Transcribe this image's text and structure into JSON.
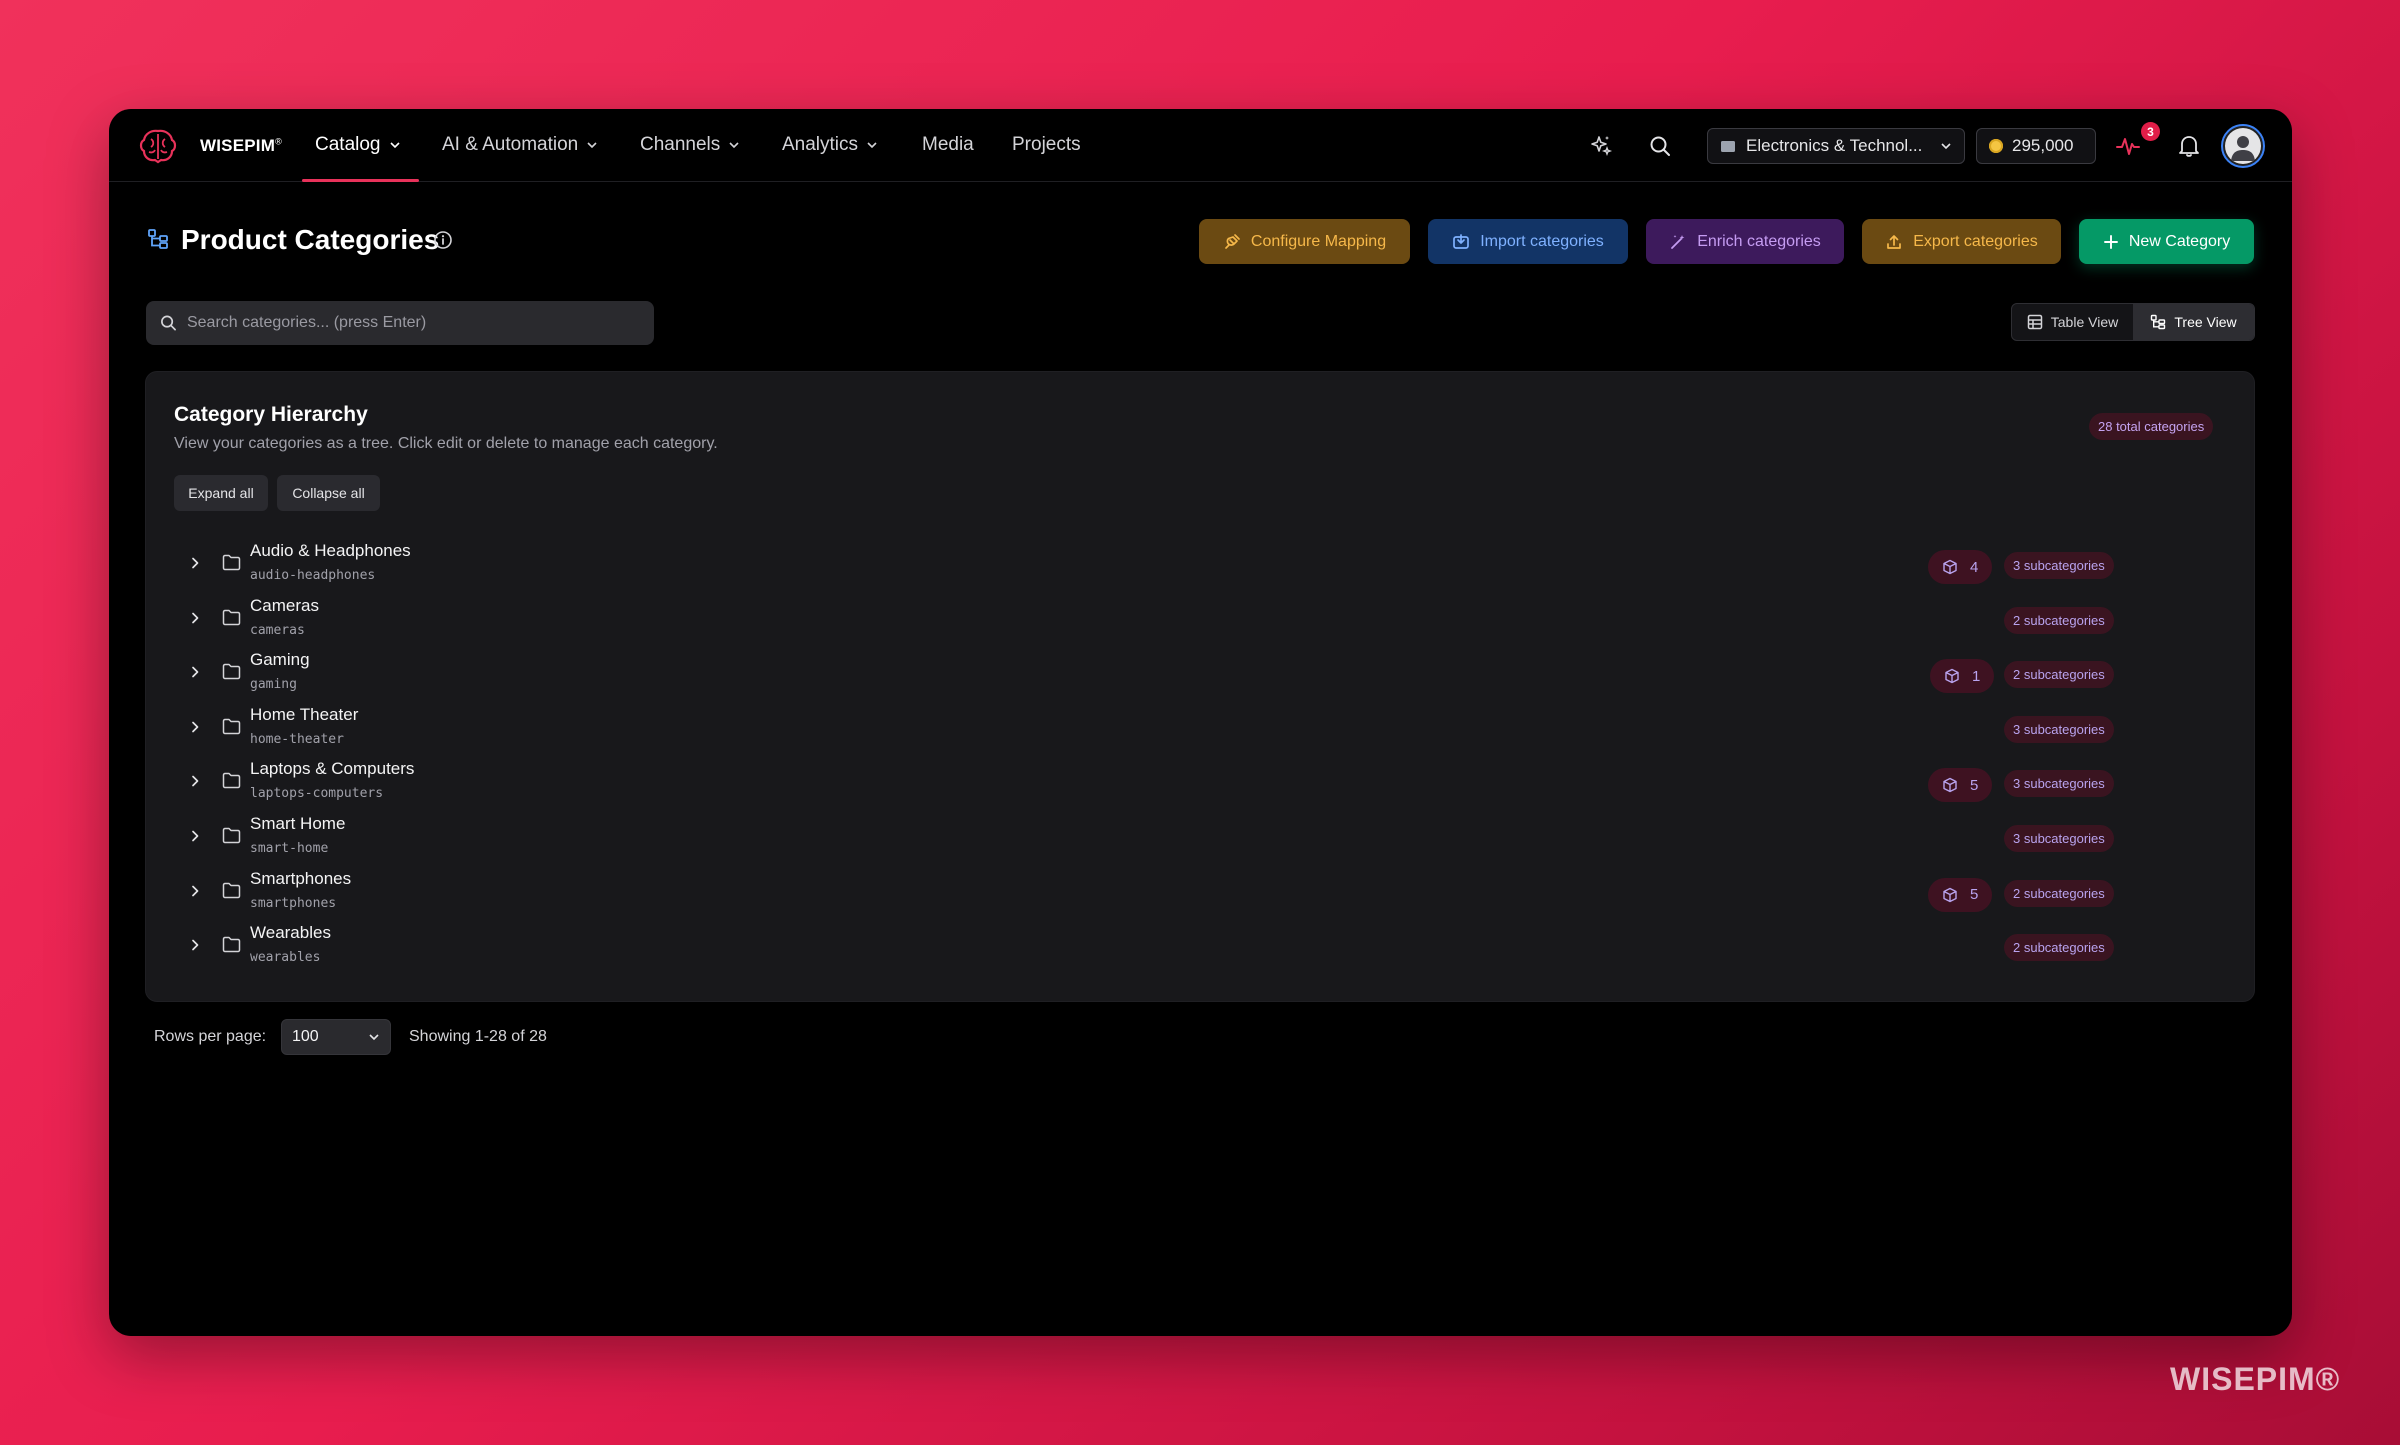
{
  "brand": {
    "name": "WISEPIM",
    "mark": "®"
  },
  "nav": {
    "items": [
      {
        "label": "Catalog",
        "active": true,
        "dropdown": true
      },
      {
        "label": "AI & Automation",
        "dropdown": true
      },
      {
        "label": "Channels",
        "dropdown": true
      },
      {
        "label": "Analytics",
        "dropdown": true
      },
      {
        "label": "Media",
        "dropdown": false
      },
      {
        "label": "Projects",
        "dropdown": false
      }
    ],
    "org_select": "Electronics & Technol...",
    "credits": "295,000",
    "activity_count": "3"
  },
  "page": {
    "title": "Product Categories",
    "actions": {
      "configure_mapping": "Configure Mapping",
      "import": "Import categories",
      "enrich": "Enrich categories",
      "export": "Export categories",
      "new": "New Category"
    },
    "search_placeholder": "Search categories... (press Enter)",
    "view_toggle": {
      "table": "Table View",
      "tree": "Tree View",
      "active": "tree"
    }
  },
  "card": {
    "title": "Category Hierarchy",
    "subtitle": "View your categories as a tree. Click edit or delete to manage each category.",
    "total_badge": "28 total categories",
    "expand_all": "Expand all",
    "collapse_all": "Collapse all",
    "rows": [
      {
        "name": "Audio & Headphones",
        "slug": "audio-headphones",
        "products": "4",
        "subcategories": "3 subcategories"
      },
      {
        "name": "Cameras",
        "slug": "cameras",
        "products": null,
        "subcategories": "2 subcategories"
      },
      {
        "name": "Gaming",
        "slug": "gaming",
        "products": "1",
        "subcategories": "2 subcategories"
      },
      {
        "name": "Home Theater",
        "slug": "home-theater",
        "products": null,
        "subcategories": "3 subcategories"
      },
      {
        "name": "Laptops & Computers",
        "slug": "laptops-computers",
        "products": "5",
        "subcategories": "3 subcategories"
      },
      {
        "name": "Smart Home",
        "slug": "smart-home",
        "products": null,
        "subcategories": "3 subcategories"
      },
      {
        "name": "Smartphones",
        "slug": "smartphones",
        "products": "5",
        "subcategories": "2 subcategories"
      },
      {
        "name": "Wearables",
        "slug": "wearables",
        "products": null,
        "subcategories": "2 subcategories"
      }
    ]
  },
  "footer": {
    "rows_per_page_label": "Rows per page:",
    "rows_per_page_value": "100",
    "showing": "Showing 1-28 of 28"
  },
  "watermark": "WISEPIM®",
  "colors": {
    "accent": "#e8325a",
    "new_button": "#059966",
    "import_button": "#123466",
    "enrich_button": "#3d1a5c",
    "amber_button": "#6b4a12"
  }
}
